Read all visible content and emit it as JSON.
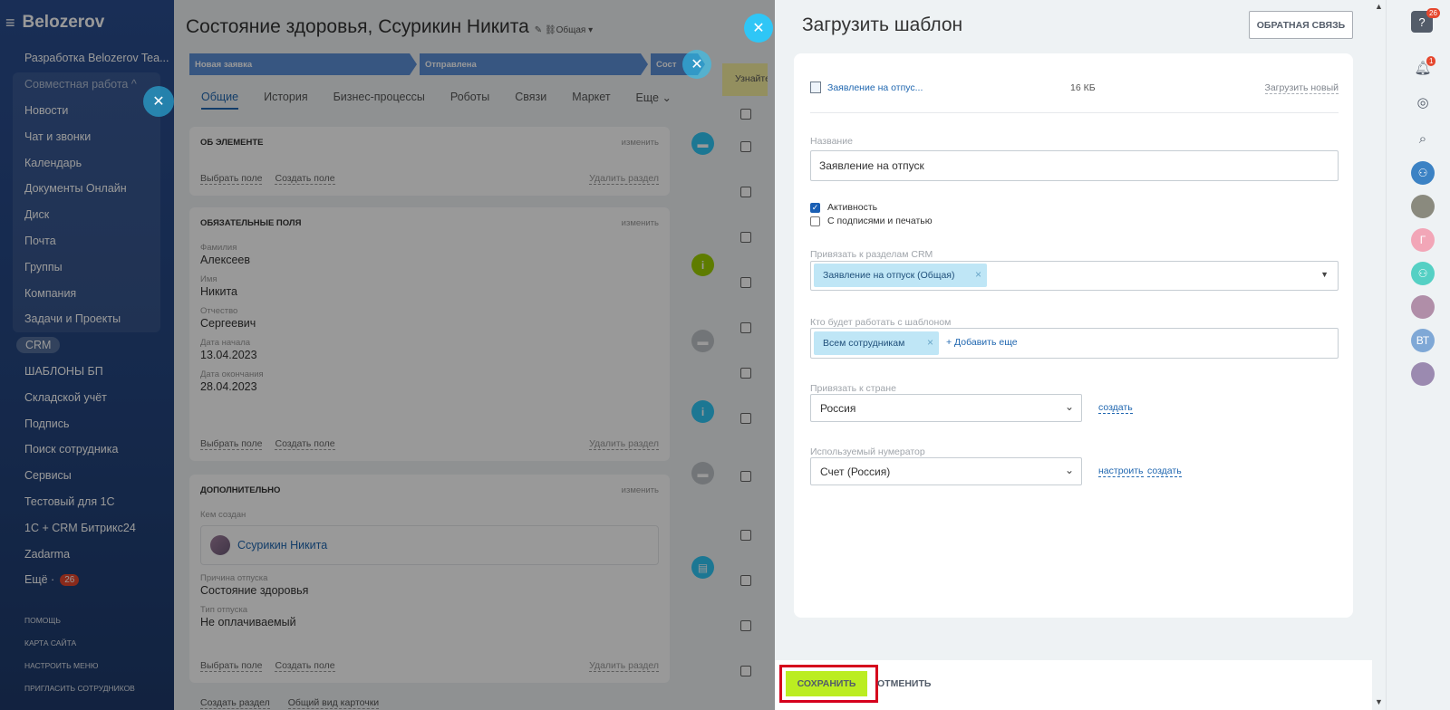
{
  "sidebar": {
    "logo": "Belozerov",
    "items": [
      {
        "label": "Разработка Belozerov Tea...",
        "muted": false
      },
      {
        "label": "Совместная работа ^",
        "muted": true
      },
      {
        "label": "Новости",
        "muted": false
      },
      {
        "label": "Чат и звонки",
        "muted": false
      },
      {
        "label": "Календарь",
        "muted": false
      },
      {
        "label": "Документы Онлайн",
        "muted": false
      },
      {
        "label": "Диск",
        "muted": false
      },
      {
        "label": "Почта",
        "muted": false
      },
      {
        "label": "Группы",
        "muted": false
      },
      {
        "label": "Компания",
        "muted": false
      },
      {
        "label": "Задачи и Проекты",
        "muted": false
      },
      {
        "label": "CRM",
        "muted": false,
        "pill": true
      },
      {
        "label": "ШАБЛОНЫ БП",
        "muted": false
      },
      {
        "label": "Складской учёт",
        "muted": false
      },
      {
        "label": "Подпись",
        "muted": false
      },
      {
        "label": "Поиск сотрудника",
        "muted": false
      },
      {
        "label": "Сервисы",
        "muted": false
      },
      {
        "label": "Тестовый для 1С",
        "muted": false
      },
      {
        "label": "1С + CRM Битрикс24",
        "muted": false
      },
      {
        "label": "Zadarma",
        "muted": false
      },
      {
        "label": "Ещё ·",
        "muted": false,
        "badge": "26"
      }
    ],
    "bottom_links": [
      "ПОМОЩЬ",
      "КАРТА САЙТА",
      "НАСТРОИТЬ МЕНЮ",
      "ПРИГЛАСИТЬ СОТРУДНИКОВ"
    ]
  },
  "crm": {
    "title": "Состояние здоровья, Ссурикин Никита",
    "title_suffix": "✎ ⛓Общая ▾",
    "stages": [
      "Новая заявка",
      "Отправлена",
      "Сост"
    ],
    "tabs": [
      "Общие",
      "История",
      "Бизнес-процессы",
      "Роботы",
      "Связи",
      "Маркет",
      "Еще ⌄"
    ],
    "card1": {
      "title": "ОБ ЭЛЕМЕНТЕ",
      "edit": "изменить",
      "links": [
        "Выбрать поле",
        "Создать поле"
      ],
      "delete": "Удалить раздел"
    },
    "card2": {
      "title": "ОБЯЗАТЕЛЬНЫЕ ПОЛЯ",
      "edit": "изменить",
      "fields": [
        {
          "label": "Фамилия",
          "value": "Алексеев"
        },
        {
          "label": "Имя",
          "value": "Никита"
        },
        {
          "label": "Отчество",
          "value": "Сергеевич"
        },
        {
          "label": "Дата начала",
          "value": "13.04.2023"
        },
        {
          "label": "Дата окончания",
          "value": "28.04.2023"
        }
      ],
      "links": [
        "Выбрать поле",
        "Создать поле"
      ],
      "delete": "Удалить раздел"
    },
    "card3": {
      "title": "ДОПОЛНИТЕЛЬНО",
      "edit": "изменить",
      "creator_label": "Кем создан",
      "creator": "Ссурикин Никита",
      "fields": [
        {
          "label": "Причина отпуска",
          "value": "Состояние здоровья"
        },
        {
          "label": "Тип отпуска",
          "value": "Не оплачиваемый"
        }
      ],
      "links": [
        "Выбрать поле",
        "Создать поле"
      ],
      "delete": "Удалить раздел"
    },
    "bottom_links": [
      "Создать раздел",
      "Общий вид карточки"
    ],
    "timeline_hint": "Узнайте"
  },
  "panel": {
    "title": "Загрузить шаблон",
    "feedback_button": "ОБРАТНАЯ СВЯЗЬ",
    "file": {
      "name": "Заявление на отпус...",
      "size": "16 КБ",
      "upload_new": "Загрузить новый"
    },
    "name_label": "Название",
    "name_value": "Заявление на отпуск",
    "checkbox_active": {
      "label": "Активность",
      "checked": true
    },
    "checkbox_signatures": {
      "label": "С подписями и печатью",
      "checked": false
    },
    "crm_label": "Привязать к разделам CRM",
    "crm_tag": "Заявление на отпуск (Общая)",
    "who_label": "Кто будет работать с шаблоном",
    "who_tag": "Всем сотрудникам",
    "add_more": "+ Добавить еще",
    "country_label": "Привязать к стране",
    "country_value": "Россия",
    "country_create": "создать",
    "numerator_label": "Используемый нумератор",
    "numerator_value": "Счет (Россия)",
    "numerator_configure": "настроить",
    "numerator_create": "создать",
    "save_button": "СОХРАНИТЬ",
    "cancel_button": "ОТМЕНИТЬ"
  },
  "rightbar": {
    "help_badge": "26",
    "notify_badge": "1",
    "avatar_initials_1": "Г",
    "avatar_initials_2": "ВТ"
  },
  "colors": {
    "sidebar_bg": "#2a4d8f",
    "accent_blue": "#2067b0",
    "save_green": "#bbed21",
    "highlight_red": "#d5001c",
    "tag_blue": "#bfe6f6"
  }
}
